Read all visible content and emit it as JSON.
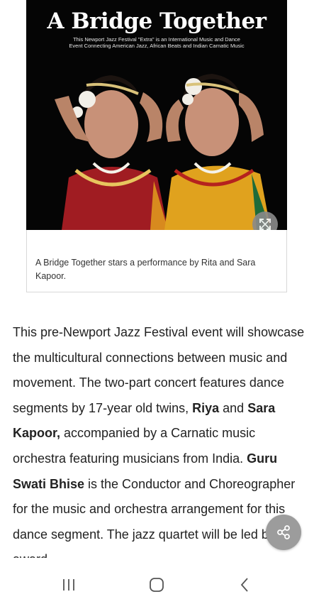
{
  "figure": {
    "poster_title": "A Bridge Together",
    "poster_subtitle_line1": "This Newport Jazz Festival \"Extra\" is an International Music and Dance",
    "poster_subtitle_line2": "Event Connecting American Jazz, African Beats and Indian Carnatic Music",
    "caption": "A Bridge Together stars a performance by Rita and Sara Kapoor.",
    "expand_icon": "expand-icon"
  },
  "article": {
    "p1": "This pre-Newport Jazz Festival event will showcase the multicultural connections between music and movement. The two-part concert features dance segments by 17-year old twins, ",
    "name1": "Riya",
    "and": " and ",
    "name2": "Sara Kapoor,",
    "p2": " accompanied by a Carnatic music orchestra featuring musicians from India. ",
    "name3": "Guru Swati Bhise",
    "p3": " is the Conductor and Choreographer for the music and orchestra arrangement for this dance segment. The jazz quartet will be led by award-"
  },
  "share_icon": "share-icon",
  "nav": {
    "recents_icon": "recents-icon",
    "home_icon": "home-icon",
    "back_icon": "back-icon"
  },
  "colors": {
    "poster_bg": "#050505",
    "fab_gray": "#9c9c9c",
    "text": "#222222"
  }
}
